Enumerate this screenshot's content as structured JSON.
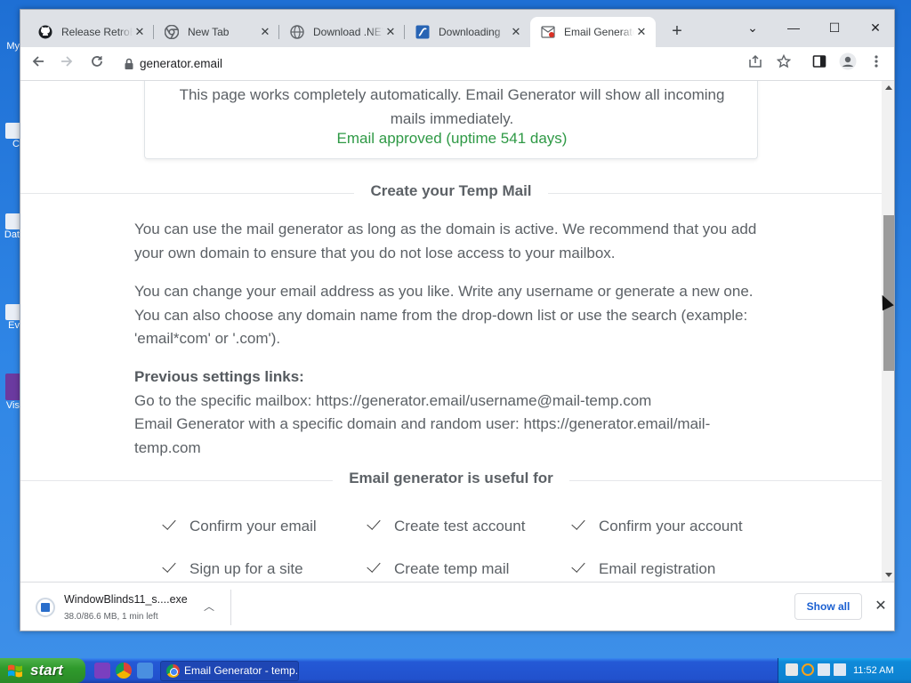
{
  "desktop": {
    "icons": [
      {
        "label": "My",
        "icon": "computer-icon"
      },
      {
        "label": "C",
        "icon": "app-icon"
      },
      {
        "label": "Dat",
        "icon": "app-icon"
      },
      {
        "label": "Ev",
        "icon": "app-icon"
      },
      {
        "label": "Vis",
        "icon": "visual-studio-icon"
      }
    ]
  },
  "browser": {
    "tabs": [
      {
        "title": "Release RetroBar",
        "icon": "github-icon",
        "active": false
      },
      {
        "title": "New Tab",
        "icon": "chrome-icon",
        "active": false
      },
      {
        "title": "Download .NET",
        "icon": "globe-icon",
        "active": false
      },
      {
        "title": "Downloading",
        "icon": "download-site-icon",
        "active": false
      },
      {
        "title": "Email Generator",
        "icon": "email-generator-icon",
        "active": true
      }
    ],
    "new_tab_label": "+",
    "url": "generator.email",
    "window_controls": {
      "tab_search": "⌄",
      "minimize": "—",
      "maximize": "☐",
      "close": "✕"
    }
  },
  "page": {
    "card": {
      "text": "This page works completely automatically. Email Generator will show all incoming mails immediately.",
      "status": "Email approved (uptime 541 days)",
      "status_color": "#2e9945"
    },
    "section1_title": "Create your Temp Mail",
    "para1": "You can use the mail generator as long as the domain is active. We recommend that you add your own domain to ensure that you do not lose access to your mailbox.",
    "para2": "You can change your email address as you like. Write any username or generate a new one. You can also choose any domain name from the drop-down list or use the search (example: 'email*com' or '.com').",
    "prev_links_heading": "Previous settings links:",
    "prev_link1": "Go to the specific mailbox: https://generator.email/username@mail-temp.com",
    "prev_link2": "Email Generator with a specific domain and random user: https://generator.email/mail-temp.com",
    "section2_title": "Email generator is useful for",
    "useful": [
      "Confirm your email",
      "Create test account",
      "Confirm your account",
      "Sign up for a site",
      "Create temp mail",
      "Email registration"
    ]
  },
  "download_shelf": {
    "filename": "WindowBlinds11_s....exe",
    "status": "38.0/86.6 MB, 1 min left",
    "show_all": "Show all"
  },
  "taskbar": {
    "start_label": "start",
    "task_label": "Email Generator - temp...",
    "clock": "11:52 AM"
  },
  "colors": {
    "link_blue": "#1a5fd1",
    "taskbar_blue": "#2151cd",
    "start_green": "#2f9a2c"
  }
}
